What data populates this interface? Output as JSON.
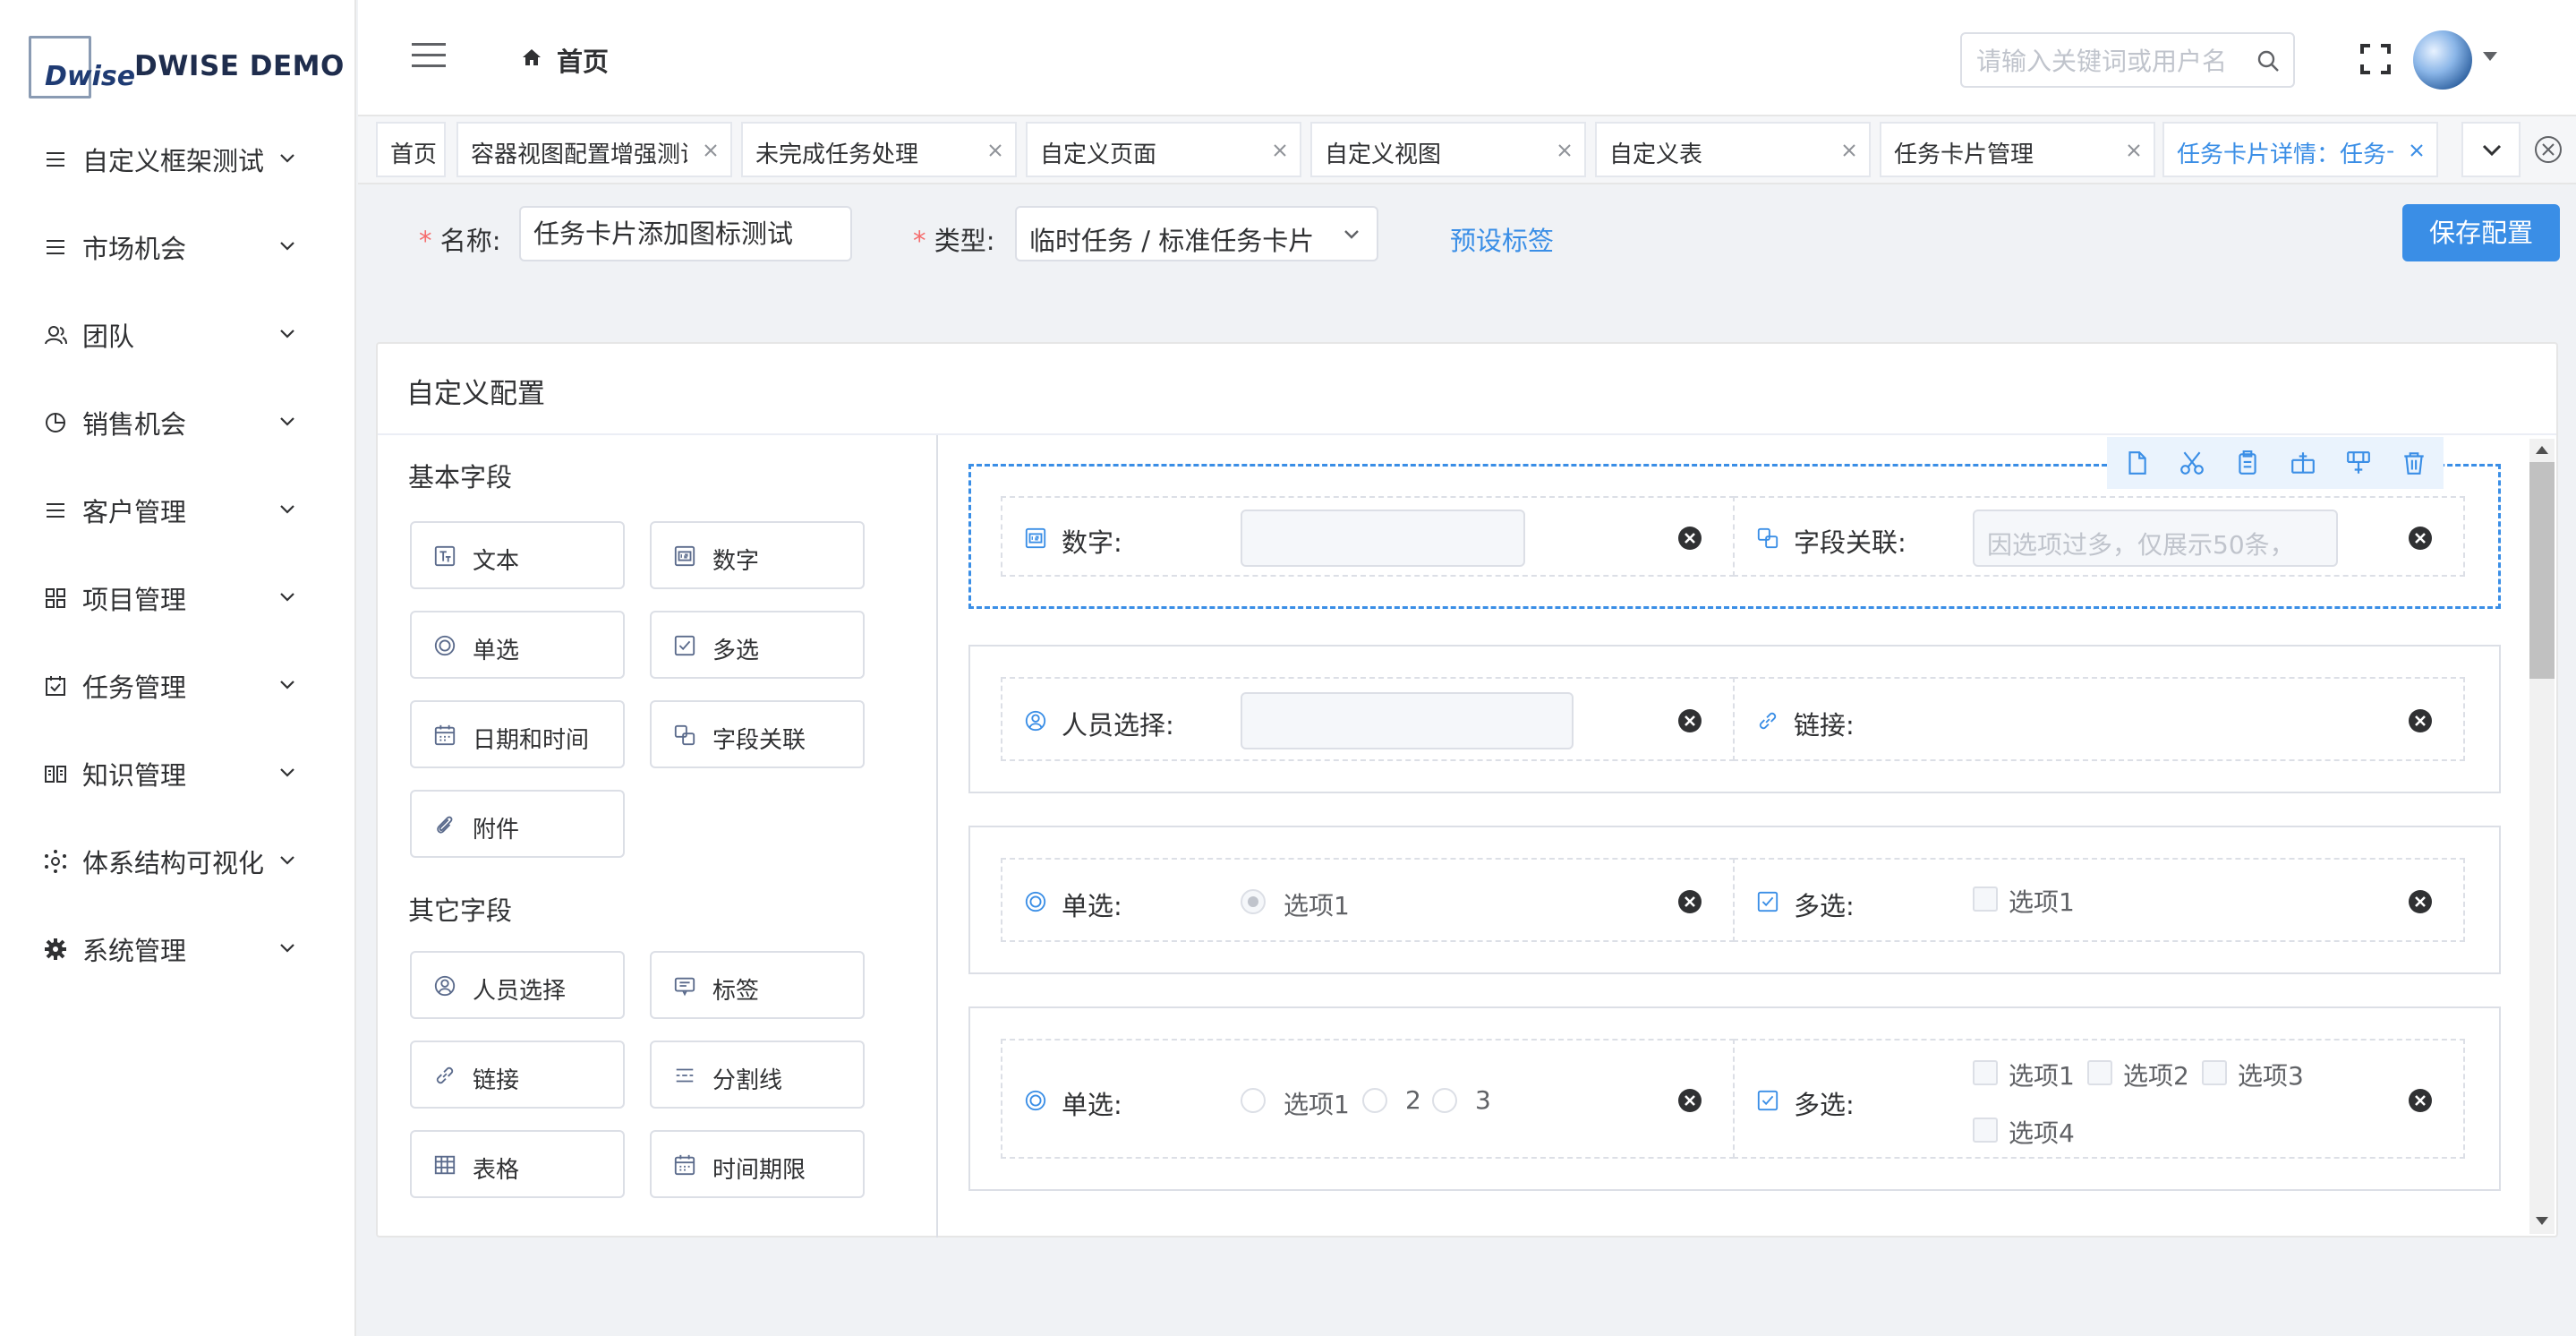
{
  "app": {
    "logo_text": "Dwise",
    "title": "DWISE DEMO"
  },
  "sidebar": {
    "items": [
      {
        "label": "自定义框架测试",
        "icon": "list-icon"
      },
      {
        "label": "市场机会",
        "icon": "list-icon"
      },
      {
        "label": "团队",
        "icon": "team-icon"
      },
      {
        "label": "销售机会",
        "icon": "pie-chart-icon"
      },
      {
        "label": "客户管理",
        "icon": "list-icon"
      },
      {
        "label": "项目管理",
        "icon": "grid-icon"
      },
      {
        "label": "任务管理",
        "icon": "calendar-check-icon"
      },
      {
        "label": "知识管理",
        "icon": "book-icon"
      },
      {
        "label": "体系结构可视化",
        "icon": "network-icon"
      },
      {
        "label": "系统管理",
        "icon": "gear-icon"
      }
    ]
  },
  "header": {
    "breadcrumb": "首页",
    "search_placeholder": "请输入关键词或用户名"
  },
  "tabs": [
    {
      "label": "首页",
      "closable": false,
      "active": false
    },
    {
      "label": "容器视图配置增强测试",
      "closable": true,
      "active": false
    },
    {
      "label": "未完成任务处理",
      "closable": true,
      "active": false
    },
    {
      "label": "自定义页面",
      "closable": true,
      "active": false
    },
    {
      "label": "自定义视图",
      "closable": true,
      "active": false
    },
    {
      "label": "自定义表",
      "closable": true,
      "active": false
    },
    {
      "label": "任务卡片管理",
      "closable": true,
      "active": false
    },
    {
      "label": "任务卡片详情：任务卡",
      "closable": true,
      "active": true
    }
  ],
  "config": {
    "name_label": "名称:",
    "name_value": "任务卡片添加图标测试",
    "type_label": "类型:",
    "type_value": "临时任务 / 标准任务卡片",
    "preset_link": "预设标签",
    "save_button": "保存配置",
    "required_mark": "*"
  },
  "panel": {
    "title": "自定义配置",
    "basic_section": "基本字段",
    "basic_fields": [
      {
        "label": "文本",
        "icon": "text-field-icon"
      },
      {
        "label": "数字",
        "icon": "number-field-icon"
      },
      {
        "label": "单选",
        "icon": "radio-icon"
      },
      {
        "label": "多选",
        "icon": "checkbox-icon"
      },
      {
        "label": "日期和时间",
        "icon": "calendar-icon"
      },
      {
        "label": "字段关联",
        "icon": "relation-icon"
      },
      {
        "label": "附件",
        "icon": "paperclip-icon"
      }
    ],
    "other_section": "其它字段",
    "other_fields": [
      {
        "label": "人员选择",
        "icon": "user-circle-icon"
      },
      {
        "label": "标签",
        "icon": "tag-icon"
      },
      {
        "label": "链接",
        "icon": "link-icon"
      },
      {
        "label": "分割线",
        "icon": "divider-icon"
      },
      {
        "label": "表格",
        "icon": "table-icon"
      },
      {
        "label": "时间期限",
        "icon": "calendar-icon"
      }
    ]
  },
  "canvas": {
    "rows": [
      {
        "cells": [
          {
            "label": "数字:",
            "icon": "number-field-icon",
            "kind": "input",
            "placeholder": ""
          },
          {
            "label": "字段关联:",
            "icon": "relation-icon",
            "kind": "input",
            "placeholder": "因选项过多，仅展示50条，"
          }
        ]
      },
      {
        "cells": [
          {
            "label": "人员选择:",
            "icon": "user-circle-icon",
            "kind": "input",
            "placeholder": ""
          },
          {
            "label": "链接:",
            "icon": "link-icon",
            "kind": "none"
          }
        ]
      },
      {
        "cells": [
          {
            "label": "单选:",
            "icon": "radio-icon",
            "kind": "radio",
            "options": [
              "选项1"
            ]
          },
          {
            "label": "多选:",
            "icon": "checkbox-icon",
            "kind": "check",
            "options": [
              "选项1"
            ]
          }
        ]
      },
      {
        "cells": [
          {
            "label": "单选:",
            "icon": "radio-icon",
            "kind": "radio",
            "options": [
              "选项1",
              "2",
              "3"
            ]
          },
          {
            "label": "多选:",
            "icon": "checkbox-icon",
            "kind": "check",
            "options": [
              "选项1",
              "选项2",
              "选项3",
              "选项4"
            ]
          }
        ]
      }
    ],
    "toolbar": [
      "copy-icon",
      "cut-icon",
      "paste-icon",
      "insert-row-below-icon",
      "insert-row-above-icon",
      "delete-icon"
    ]
  },
  "colors": {
    "accent": "#3a8ee6",
    "required": "#f56c6c",
    "border": "#dcdfe6"
  }
}
